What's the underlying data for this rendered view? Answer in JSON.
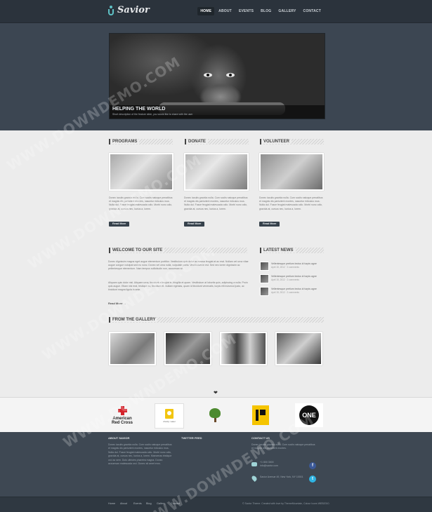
{
  "header": {
    "logo": "Savior",
    "nav": [
      {
        "label": "HOME",
        "active": true
      },
      {
        "label": "ABOUT",
        "active": false
      },
      {
        "label": "EVENTS",
        "active": false
      },
      {
        "label": "BLOG",
        "active": false
      },
      {
        "label": "GALLERY",
        "active": false
      },
      {
        "label": "CONTACT",
        "active": false
      }
    ]
  },
  "hero": {
    "title": "HELPING THE WORLD",
    "description": "Short description of the feature slide, you would like to share with the user"
  },
  "columns": [
    {
      "title": "PROGRAMS",
      "text": "Donec iaculis gravida nulla. Cum sociis natoque penatibus et magnis dis parturient montes, nascetur ridiculus mus. Nulla dui. Fusce feugiat malesuada odio. Morbi nunc odio, gravida at, cursus nec, luctus a, lorem.",
      "button": "Read More"
    },
    {
      "title": "DONATE",
      "text": "Donec iaculis gravida nulla. Cum sociis natoque penatibus et magnis dis parturient montes, nascetur ridiculus mus. Nulla dui. Fusce feugiat malesuada odio. Morbi nunc odio, gravida at, cursus nec, luctus a, lorem.",
      "button": "Read More"
    },
    {
      "title": "VOLUNTEER",
      "text": "Donec iaculis gravida nulla. Cum sociis natoque penatibus et magnis dis parturient montes, nascetur ridiculus mus. Nulla dui. Fusce feugiat malesuada odio. Morbi nunc odio, gravida at, cursus nec, luctus a, lorem.",
      "button": "Read More"
    }
  ],
  "welcome": {
    "title": "WELCOME TO OUR SITE",
    "paragraph1": "Donec dignissim magna eget augue elementum porttitor. Vestibulum quis dolor ac massa feugiat at ac erat. Nullam vel urna vitae augue congue volutpat sed eu nunc. Donec vel urna nulla, vulputate porta. Vestibulum in est. Sed nec lorem dignissim ac pellentesque elementum. Nam tempus sollicitudin non, accumsan sit.",
    "paragraph2": "Aliquam quis dolor nisl. Aliquam urna, tincidunt a feugiat in, fringilla et quam. Vestibulum at lobortis quis, adipiscing a nulla. Proin quis augue. Etiam nisl erat, tristique eu, tincidunt et. Nullam egestas, quam id tincidunt venenatis, turpis elit euismod justo, ac tincidunt magna ligula in ante.",
    "read_more": "Read More"
  },
  "news": {
    "title": "LATEST NEWS",
    "items": [
      {
        "title": "Vellentesque pretium lectus id turpis agne",
        "meta": "April 15, 2012 · 2 comments"
      },
      {
        "title": "Vellentesque pretium lectus id turpis agne",
        "meta": "April 15, 2012 · 2 comments"
      },
      {
        "title": "Vellentesque pretium lectus id turpis agne",
        "meta": "April 15, 2012 · 2 comments"
      }
    ]
  },
  "gallery": {
    "title": "FROM THE GALLERY"
  },
  "partners": {
    "redcross_line1": "American",
    "redcross_line2": "Red Cross",
    "charity_water": "charity: water",
    "one": "ONE"
  },
  "footer": {
    "about_title": "ABOUT SAVIOR",
    "about_text": "Donec iaculis gravida nulla. Cum sociis natoque penatibus et magnis dis parturient montes, nascetur ridiculus mus. Nulla dui. Fusce feugiat malesuada odio. Morbi nunc odio, gravida at, cursus nec, luctus a, lorem. Maecenas tristique orci ac sem. Duis ultricies pharetra magna. Donec accumsan malesuada orci. Donec sit amet eros.",
    "twitter_title": "TWITTER FEED",
    "contact_title": "CONTACT US",
    "contact_text": "Donec iaculis gravida nulla. Cum sociis natoque penatibus et magnis dis parturient montes.",
    "phone": "+1 800 3000",
    "email": "info@savior.com",
    "address": "Savior Avenue 49, New York, NY 10001"
  },
  "bottom": {
    "links": [
      "Home",
      "About",
      "Events",
      "Blog",
      "Gallery",
      "Contact"
    ],
    "copyright": "© Savior Theme. Created with love by ThemeMountain, Colour Icons WEB2010."
  },
  "watermark": "WWW.DOWNDEMO.COM"
}
